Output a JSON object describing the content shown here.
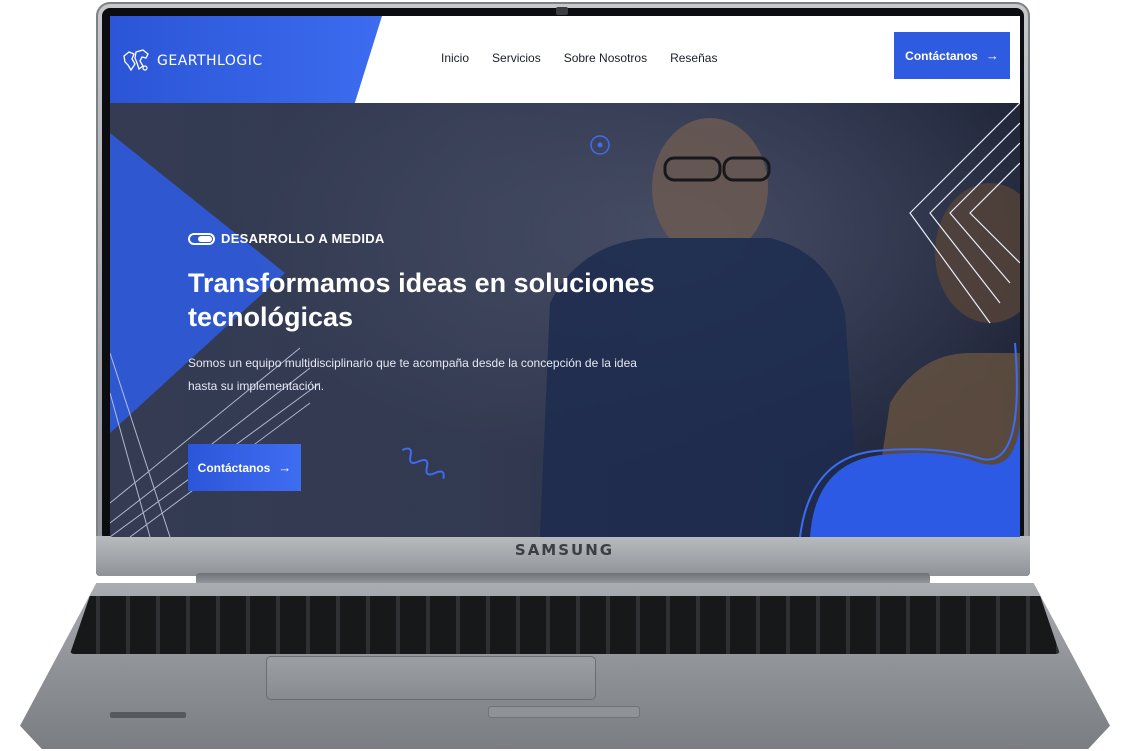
{
  "device": {
    "brand": "SAMSUNG"
  },
  "navbar": {
    "logo_text": "GEARTHLOGIC",
    "links": [
      "Inicio",
      "Servicios",
      "Sobre Nosotros",
      "Reseñas"
    ],
    "cta_label": "Contáctanos"
  },
  "hero": {
    "eyebrow": "DESARROLLO A MEDIDA",
    "title": "Transformamos ideas en soluciones tecnológicas",
    "description": "Somos un equipo multidisciplinario que te acompaña desde la concepción de la idea hasta su implementación.",
    "cta_label": "Contáctanos"
  },
  "icons": {
    "logo": "world-map-icon",
    "cta_arrow": "arrow-right-icon",
    "eyebrow": "toggle-icon"
  },
  "colors": {
    "accent": "#2e5be0",
    "hero_dark": "#2a3048",
    "nav_text": "#1b1f2b"
  }
}
